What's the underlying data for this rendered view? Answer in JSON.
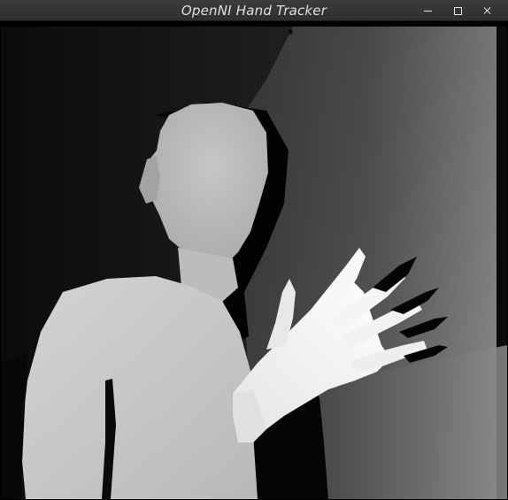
{
  "window": {
    "title": "OpenNI Hand Tracker",
    "controls": {
      "minimize_icon": "minimize-icon",
      "maximize_icon": "maximize-icon",
      "close_icon": "close-icon"
    }
  },
  "canvas": {
    "content": "depth-image",
    "colors": {
      "background": "#000000",
      "far_wall_dark": "#2e2e2e",
      "far_wall_light": "#8c8c8c",
      "body": "#c8c8c8",
      "hand": "#f4f4f4"
    }
  }
}
